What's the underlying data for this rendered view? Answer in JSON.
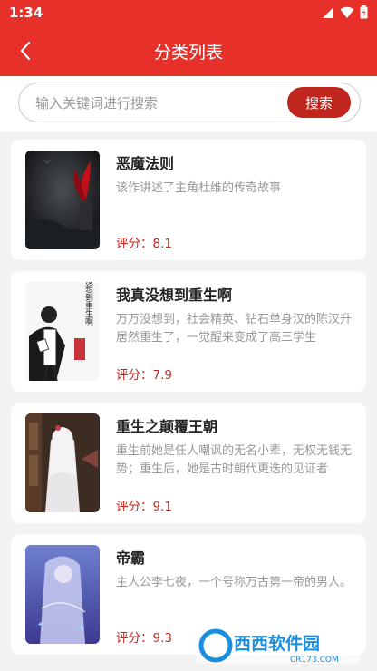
{
  "status_bar": {
    "time": "1:34"
  },
  "app_bar": {
    "title": "分类列表"
  },
  "search": {
    "placeholder": "输入关键词进行搜索",
    "button_label": "搜索"
  },
  "books": [
    {
      "title": "恶魔法则",
      "description": "该作讲述了主角杜维的传奇故事",
      "rating": "评分：8.1"
    },
    {
      "title": "我真没想到重生啊",
      "description": "万万没想到，社会精英、钻石单身汉的陈汉升居然重生了，一觉醒来变成了高三学生",
      "rating": "评分：7.9"
    },
    {
      "title": "重生之颠覆王朝",
      "description": "重生前她是任人嘲讽的无名小辈，无权无钱无势；重生后，她是古时朝代更迭的见证者",
      "rating": "评分：9.1"
    },
    {
      "title": "帝霸",
      "description": "主人公李七夜，一个号称万古第一帝的男人。",
      "rating": "评分：9.3"
    }
  ],
  "covers": {
    "1": {
      "vertical_text": "我真没想到重生啊"
    }
  },
  "watermark": {
    "text": "西西软件园",
    "sub_text": "CR173.COM"
  },
  "colors": {
    "primary": "#e8302b",
    "button": "#c0261d",
    "rating": "#c0261d"
  }
}
